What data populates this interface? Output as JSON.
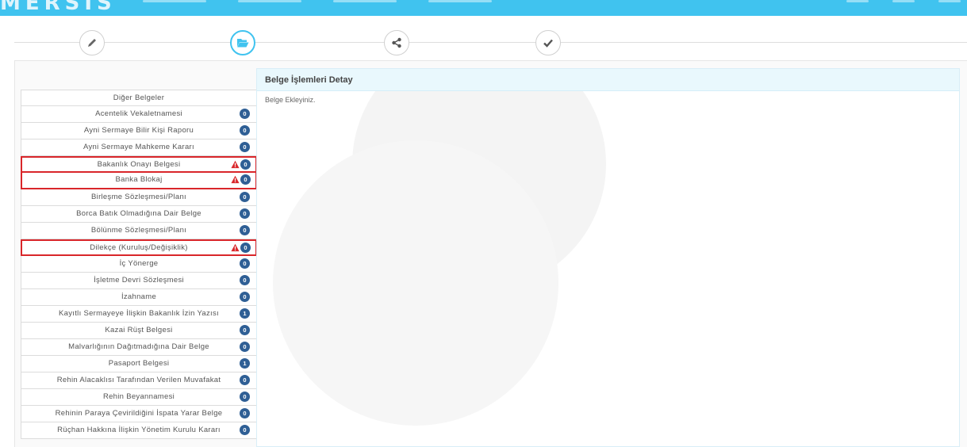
{
  "app": {
    "logo": "MERSIS"
  },
  "wizard": {
    "steps": [
      {
        "icon": "pencil-icon",
        "active": false
      },
      {
        "icon": "folder-open-icon",
        "active": true
      },
      {
        "icon": "share-icon",
        "active": false
      },
      {
        "icon": "check-icon",
        "active": false
      }
    ]
  },
  "documents": {
    "header": "Diğer Belgeler",
    "items": [
      {
        "label": "Acentelik Vekaletnamesi",
        "count": "0",
        "warning": false
      },
      {
        "label": "Ayni Sermaye Bilir Kişi Raporu",
        "count": "0",
        "warning": false
      },
      {
        "label": "Ayni Sermaye Mahkeme Kararı",
        "count": "0",
        "warning": false
      },
      {
        "label": "Bakanlık Onayı Belgesi",
        "count": "0",
        "warning": true
      },
      {
        "label": "Banka Blokaj",
        "count": "0",
        "warning": true
      },
      {
        "label": "Birleşme Sözleşmesi/Planı",
        "count": "0",
        "warning": false
      },
      {
        "label": "Borca Batık Olmadığına Dair Belge",
        "count": "0",
        "warning": false
      },
      {
        "label": "Bölünme Sözleşmesi/Planı",
        "count": "0",
        "warning": false
      },
      {
        "label": "Dilekçe (Kuruluş/Değişiklik)",
        "count": "0",
        "warning": true
      },
      {
        "label": "İç Yönerge",
        "count": "0",
        "warning": false
      },
      {
        "label": "İşletme Devri Sözleşmesi",
        "count": "0",
        "warning": false
      },
      {
        "label": "İzahname",
        "count": "0",
        "warning": false
      },
      {
        "label": "Kayıtlı Sermayeye İlişkin Bakanlık İzin Yazısı",
        "count": "1",
        "warning": false
      },
      {
        "label": "Kazai Rüşt Belgesi",
        "count": "0",
        "warning": false
      },
      {
        "label": "Malvarlığının Dağıtmadığına Dair Belge",
        "count": "0",
        "warning": false
      },
      {
        "label": "Pasaport Belgesi",
        "count": "1",
        "warning": false
      },
      {
        "label": "Rehin Alacaklısı Tarafından Verilen Muvafakat",
        "count": "0",
        "warning": false
      },
      {
        "label": "Rehin Beyannamesi",
        "count": "0",
        "warning": false
      },
      {
        "label": "Rehinin Paraya Çevirildiğini İspata Yarar Belge",
        "count": "0",
        "warning": false
      },
      {
        "label": "Rüçhan Hakkına İlişkin Yönetim Kurulu Kararı",
        "count": "0",
        "warning": false
      }
    ]
  },
  "detail": {
    "title": "Belge İşlemleri Detay",
    "message": "Belge Ekleyiniz."
  },
  "colors": {
    "topbar": "#40c3ef",
    "badge": "#2f5f95",
    "warning": "#d9262a",
    "detail_header": "#e9f8fd"
  }
}
